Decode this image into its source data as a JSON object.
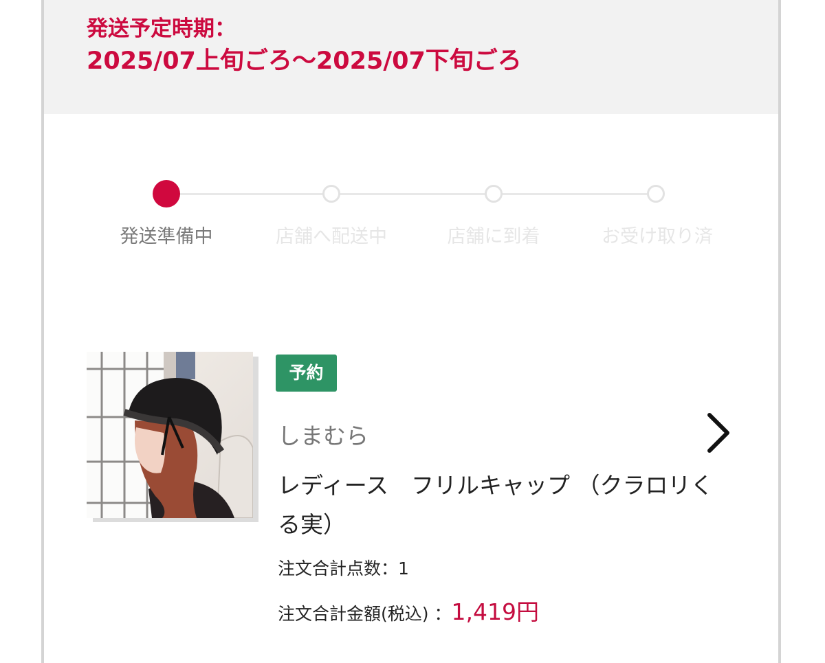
{
  "shipping": {
    "label": "発送予定時期：",
    "period": "2025/07上旬ごろ〜2025/07下旬ごろ"
  },
  "tracker": {
    "steps": [
      {
        "label": "発送準備中",
        "status": "active"
      },
      {
        "label": "店舗へ配送中",
        "status": "inactive"
      },
      {
        "label": "店舗に到着",
        "status": "inactive"
      },
      {
        "label": "お受け取り済",
        "status": "inactive"
      }
    ]
  },
  "product": {
    "badge": "予約",
    "brand": "しまむら",
    "name": "レディース　フリルキャップ （クラロリくる実）",
    "quantity_label": "注文合計点数：",
    "quantity": "1",
    "total_label": "注文合計金額(税込) ：",
    "total": "1,419円",
    "thumbnail_icon": "product-photo-frilled-bonnet",
    "detail_icon": "chevron-right-icon"
  },
  "colors": {
    "accent": "#cc0a3f",
    "badge": "#2e9465",
    "banner_bg": "#f2f2f2",
    "inactive": "#e2e2e2"
  }
}
